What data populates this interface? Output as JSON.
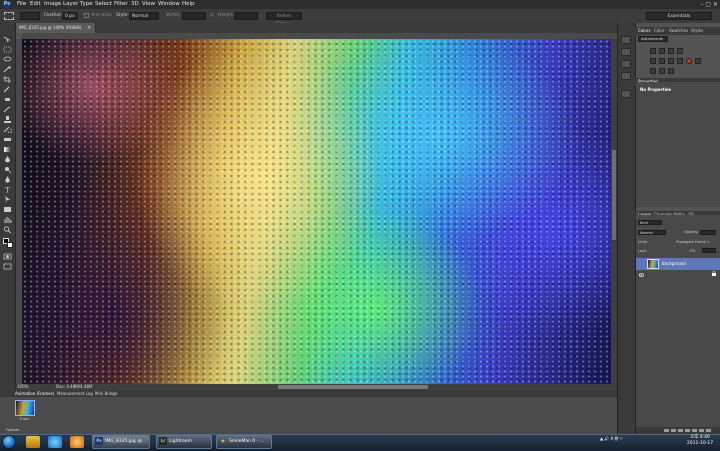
{
  "menu": {
    "logo": "Ps",
    "items": [
      "File",
      "Edit",
      "Image",
      "Layer",
      "Type",
      "Select",
      "Filter",
      "3D",
      "View",
      "Window",
      "Help"
    ],
    "window_controls": "–  ▢  ✕"
  },
  "options": {
    "feather_label": "Feather:",
    "feather_value": "0 px",
    "antialias_label": "Anti-alias",
    "style_label": "Style:",
    "style_value": "Normal",
    "width_label": "Width:",
    "height_label": "Height:",
    "refine_edge": "Refine Edge...",
    "workspace": "Essentials"
  },
  "document": {
    "tab_title": "IMG_8335.jpg @ 100% (RGB/8)",
    "zoom": "100%",
    "doc_size": "Doc: 4.48M/4.48M"
  },
  "animation_panel": {
    "tabs": [
      "Animation (Frames)",
      "Measurement Log",
      "Mini Bridge"
    ],
    "frame_delay": "0 sec.",
    "loop": "Forever"
  },
  "right_panel": {
    "top_tabs": [
      "Colors",
      "Color",
      "Swatches",
      "Styles"
    ],
    "adjustments_label": "Adjustments",
    "properties_tab": "Properties",
    "no_properties": "No Properties",
    "layers_tabs": [
      "Layers",
      "Channels",
      "Paths",
      "3D"
    ],
    "kind_label": "Kind",
    "blend_mode": "Normal",
    "opacity_label": "Opacity:",
    "lock_label": "Lock:",
    "fill_label": "Fill:",
    "unify_label": "Unify:",
    "propagate_label": "Propagate Frame 1",
    "layer_name": "Background"
  },
  "taskbar": {
    "tasks": [
      {
        "icon": "Ps",
        "label": "IMG_8335.jpg @ ..."
      },
      {
        "icon": "Lr",
        "label": "Lightroom"
      },
      {
        "icon": "◉",
        "label": "SmileMan 0 - ..."
      }
    ],
    "tray": "▲ 🔊 A 拼 ⚐",
    "time": "오후 4:49",
    "date": "2011-10-17"
  },
  "colors": {
    "accent_blue": "#5f79b8",
    "chrome_dark": "#2d2d2d",
    "panel": "#535353"
  }
}
